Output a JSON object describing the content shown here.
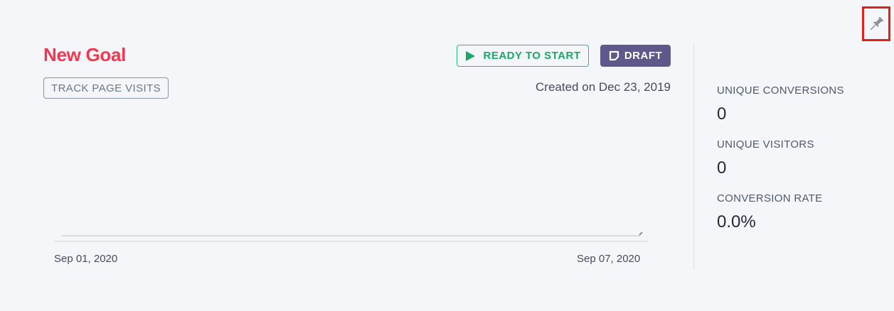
{
  "goal": {
    "title": "New Goal",
    "tag": "TRACK PAGE VISITS",
    "created": "Created on Dec 23, 2019"
  },
  "actions": {
    "start_label": "READY TO START",
    "draft_label": "DRAFT"
  },
  "chart_data": {
    "type": "line",
    "x": [
      "Sep 01, 2020",
      "Sep 07, 2020"
    ],
    "series": [
      {
        "values": [
          0,
          0
        ]
      }
    ],
    "xlabel": "",
    "ylabel": ""
  },
  "stats": [
    {
      "label": "UNIQUE CONVERSIONS",
      "value": "0"
    },
    {
      "label": "UNIQUE VISITORS",
      "value": "0"
    },
    {
      "label": "CONVERSION RATE",
      "value": "0.0%"
    }
  ],
  "icons": {
    "pin": "pushpin-icon",
    "play": "play-icon",
    "draft": "draft-icon"
  },
  "colors": {
    "title": "#f2374f",
    "start": "#1aa866",
    "draft_bg": "#5d5a8b",
    "pin_highlight": "#e0211b"
  }
}
